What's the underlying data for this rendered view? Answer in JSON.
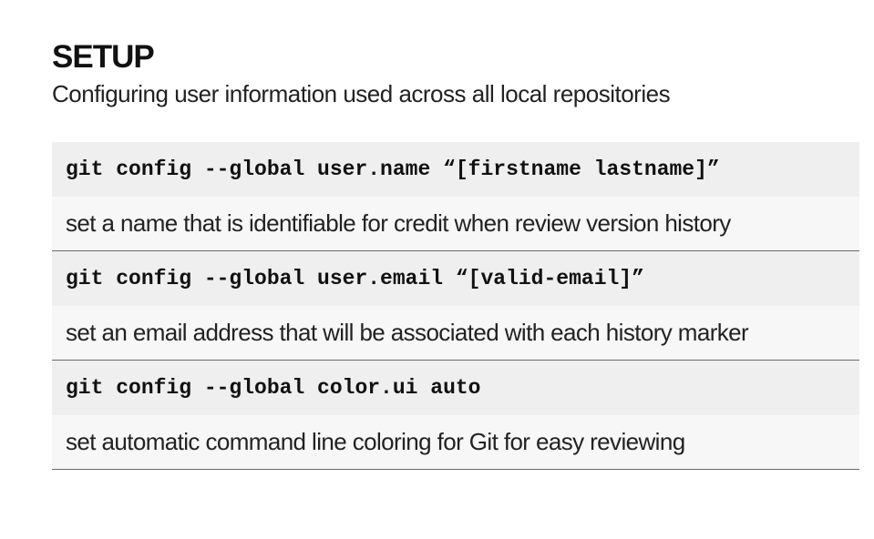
{
  "section": {
    "title": "SETUP",
    "subtitle": "Configuring user information used across all local repositories"
  },
  "entries": [
    {
      "command": "git config --global user.name “[firstname lastname]”",
      "description": "set a name that is identifiable for credit when review version history"
    },
    {
      "command": "git config --global user.email “[valid-email]”",
      "description": "set an email address that will be associated with each history marker"
    },
    {
      "command": "git config --global color.ui auto",
      "description": "set automatic command line coloring for Git for easy reviewing"
    }
  ]
}
